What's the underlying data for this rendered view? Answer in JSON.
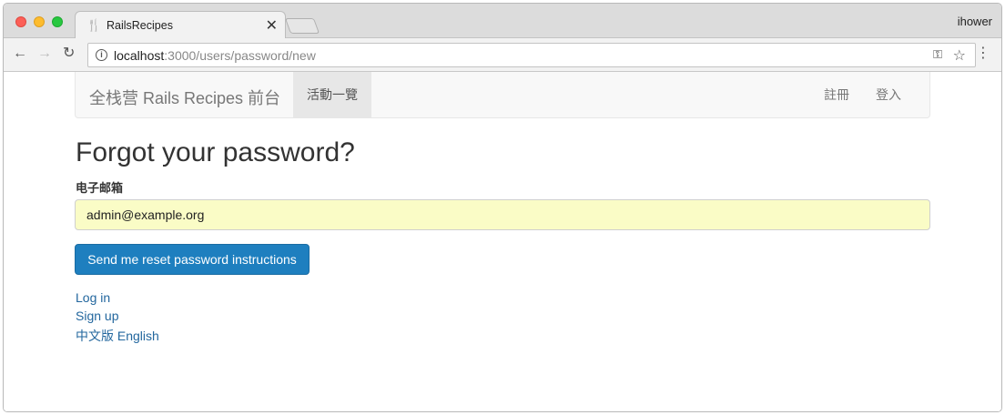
{
  "browser": {
    "tab_title": "RailsRecipes",
    "favicon": "fork-knife-icon",
    "profile_name": "ihower",
    "url_host": "localhost",
    "url_path": ":3000/users/password/new"
  },
  "navbar": {
    "brand": "全栈营 Rails Recipes 前台",
    "active_item": "活動一覽",
    "signup": "註冊",
    "login": "登入"
  },
  "form": {
    "heading": "Forgot your password?",
    "email_label": "电子邮箱",
    "email_value": "admin@example.org",
    "submit_label": "Send me reset password instructions"
  },
  "links": {
    "login": "Log in",
    "signup": "Sign up",
    "language": "中文版 English"
  },
  "colors": {
    "primary_button": "#1e7fbf",
    "link": "#23679e",
    "autofill_bg": "#fafcc6"
  }
}
